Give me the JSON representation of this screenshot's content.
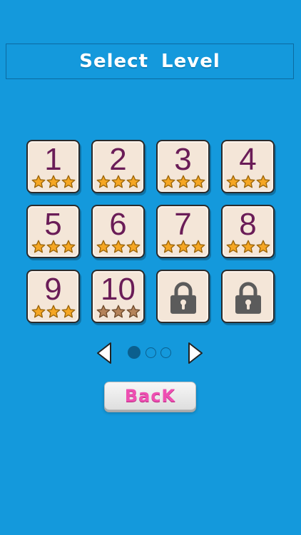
{
  "header": {
    "title": "Select Level"
  },
  "colors": {
    "background": "#1499dc",
    "tile": "#f4e6d8",
    "number": "#6a1c57",
    "star_gold": "#f5a623",
    "star_bronze": "#b5835a",
    "lock": "#5b5b5b",
    "back_label": "#ee4fb2"
  },
  "levels": [
    {
      "number": "1",
      "locked": false,
      "stars": 3,
      "star_color": "gold"
    },
    {
      "number": "2",
      "locked": false,
      "stars": 3,
      "star_color": "gold"
    },
    {
      "number": "3",
      "locked": false,
      "stars": 3,
      "star_color": "gold"
    },
    {
      "number": "4",
      "locked": false,
      "stars": 3,
      "star_color": "gold"
    },
    {
      "number": "5",
      "locked": false,
      "stars": 3,
      "star_color": "gold"
    },
    {
      "number": "6",
      "locked": false,
      "stars": 3,
      "star_color": "gold"
    },
    {
      "number": "7",
      "locked": false,
      "stars": 3,
      "star_color": "gold"
    },
    {
      "number": "8",
      "locked": false,
      "stars": 3,
      "star_color": "gold"
    },
    {
      "number": "9",
      "locked": false,
      "stars": 3,
      "star_color": "gold"
    },
    {
      "number": "10",
      "locked": false,
      "stars": 3,
      "star_color": "bronze"
    },
    {
      "number": "",
      "locked": true,
      "icon": "padlock-icon"
    },
    {
      "number": "",
      "locked": true,
      "icon": "padlock-icon"
    }
  ],
  "pager": {
    "prev_icon": "triangle-left-icon",
    "next_icon": "triangle-right-icon",
    "pages": 3,
    "current_page": 1
  },
  "back_button": {
    "label": "BacK"
  }
}
